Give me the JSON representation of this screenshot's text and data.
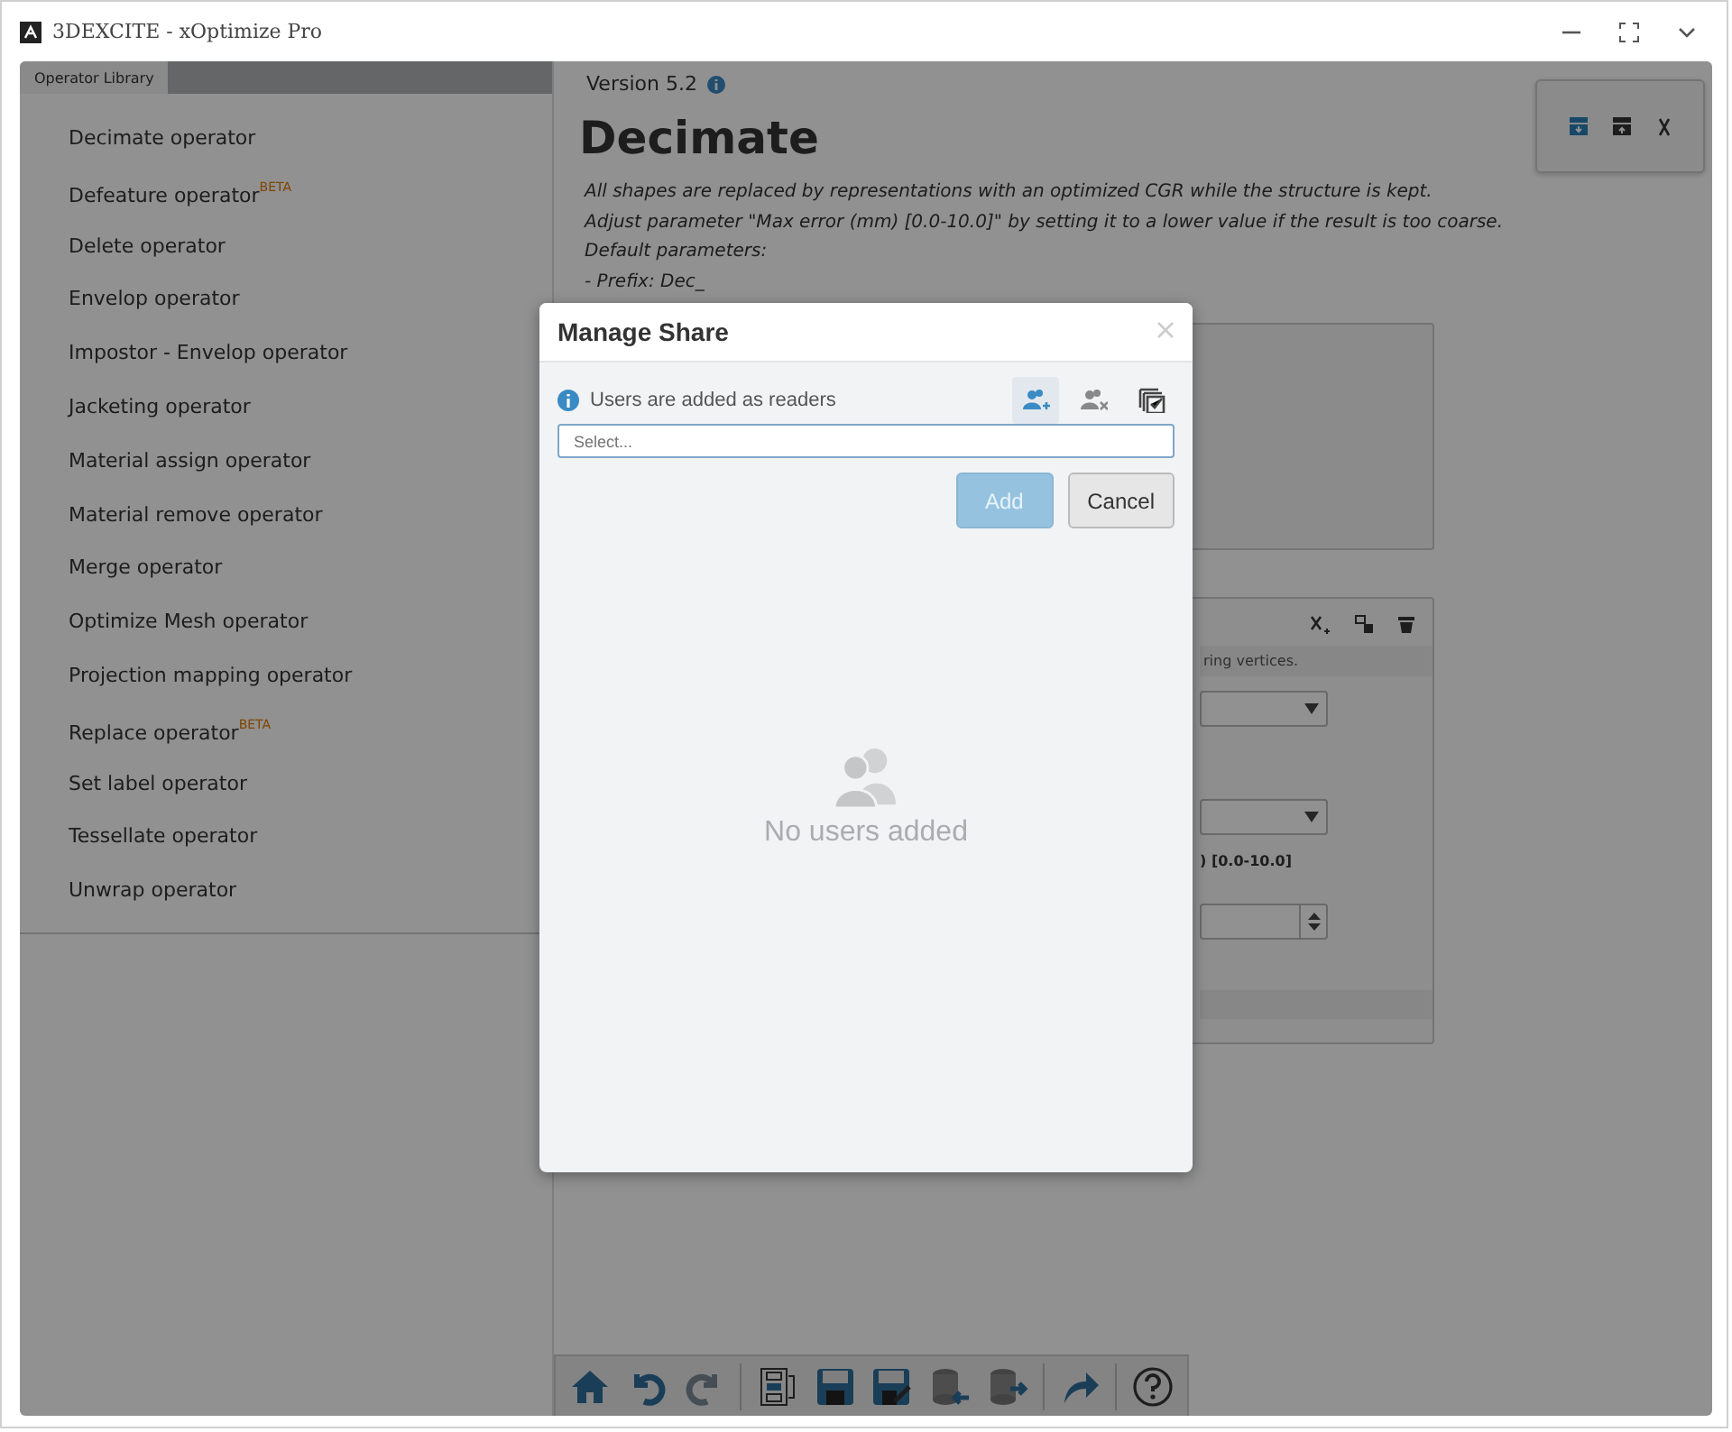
{
  "window": {
    "title": "3DEXCITE - xOptimize Pro"
  },
  "sidebar": {
    "tab": "Operator Library",
    "items": [
      {
        "label": "Decimate operator"
      },
      {
        "label": "Defeature operator",
        "badge": "BETA"
      },
      {
        "label": "Delete operator"
      },
      {
        "label": "Envelop operator"
      },
      {
        "label": "Impostor - Envelop operator"
      },
      {
        "label": "Jacketing operator"
      },
      {
        "label": "Material assign operator"
      },
      {
        "label": "Material remove operator"
      },
      {
        "label": "Merge operator"
      },
      {
        "label": "Optimize Mesh operator"
      },
      {
        "label": "Projection mapping operator"
      },
      {
        "label": "Replace operator",
        "badge": "BETA"
      },
      {
        "label": "Set label operator"
      },
      {
        "label": "Tessellate operator"
      },
      {
        "label": "Unwrap operator"
      }
    ]
  },
  "content": {
    "version": "Version 5.2",
    "title": "Decimate",
    "description": [
      "All shapes are replaced by representations with an optimized CGR while the structure is kept.",
      "Adjust parameter \"Max error (mm) [0.0-10.0]\" by setting it to a lower value if the result is too coarse.",
      "Default parameters:",
      "- Prefix: Dec_"
    ],
    "parameter_card": {
      "hint": "ring vertices.",
      "param_label": ") [0.0-10.0]"
    }
  },
  "dialog": {
    "title": "Manage Share",
    "info": "Users are added as readers",
    "tools": [
      {
        "kind": "add-user",
        "selected": true
      },
      {
        "kind": "remove-user",
        "selected": false
      },
      {
        "kind": "select-all",
        "selected": false
      }
    ],
    "search": {
      "placeholder": "Select..."
    },
    "buttons": [
      {
        "label": "Add",
        "disabled": true
      },
      {
        "label": "Cancel"
      }
    ],
    "empty": "No users added"
  }
}
